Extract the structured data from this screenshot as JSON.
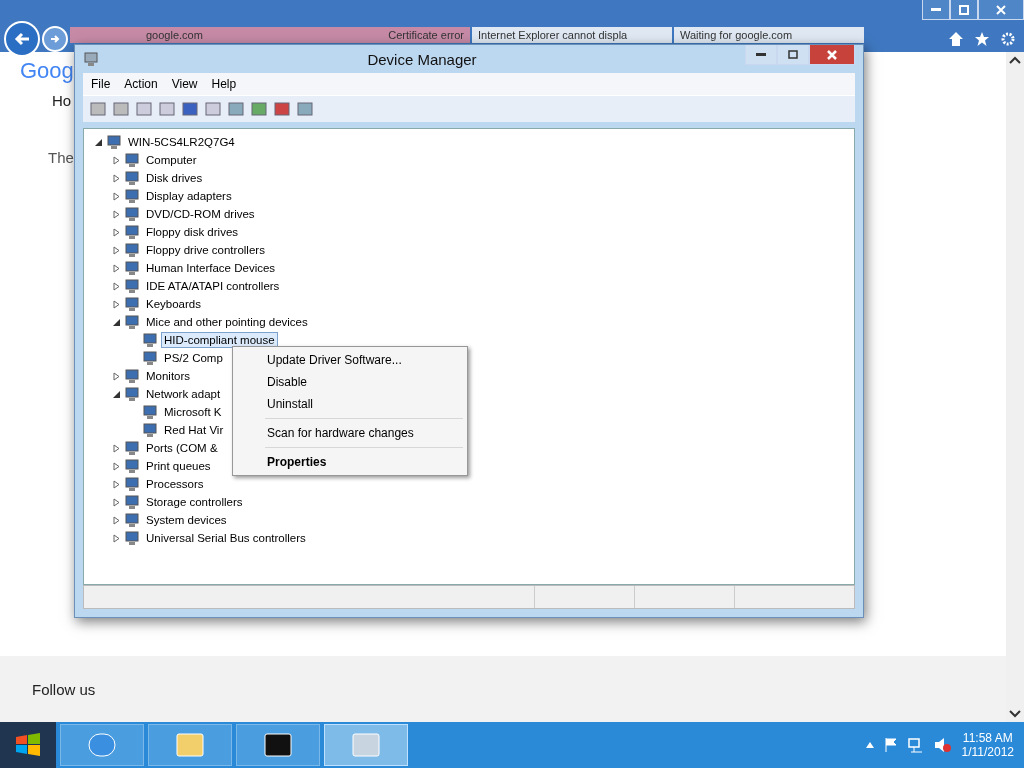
{
  "browser": {
    "tabs": [
      {
        "label": "google.com",
        "selected": true,
        "badge": "Certificate error"
      },
      {
        "label": "Internet Explorer cannot displa",
        "selected": false
      },
      {
        "label": "Waiting for google.com",
        "selected": false
      }
    ],
    "page": {
      "logo": "Goog",
      "nav": "Ho",
      "heading": "The",
      "footer": "Follow us"
    }
  },
  "window": {
    "title": "Device Manager",
    "menu": [
      "File",
      "Action",
      "View",
      "Help"
    ],
    "tree": {
      "label": "WIN-5CS4LR2Q7G4",
      "expanded": true,
      "children": [
        {
          "label": "Computer",
          "expanded": false
        },
        {
          "label": "Disk drives",
          "expanded": false
        },
        {
          "label": "Display adapters",
          "expanded": false
        },
        {
          "label": "DVD/CD-ROM drives",
          "expanded": false
        },
        {
          "label": "Floppy disk drives",
          "expanded": false
        },
        {
          "label": "Floppy drive controllers",
          "expanded": false
        },
        {
          "label": "Human Interface Devices",
          "expanded": false
        },
        {
          "label": "IDE ATA/ATAPI controllers",
          "expanded": false
        },
        {
          "label": "Keyboards",
          "expanded": false
        },
        {
          "label": "Mice and other pointing devices",
          "expanded": true,
          "children": [
            {
              "label": "HID-compliant mouse",
              "selected": true
            },
            {
              "label": "PS/2 Comp",
              "selected": false
            }
          ]
        },
        {
          "label": "Monitors",
          "expanded": false
        },
        {
          "label": "Network adapt",
          "expanded": true,
          "children": [
            {
              "label": "Microsoft K",
              "selected": false
            },
            {
              "label": "Red Hat Vir",
              "selected": false
            }
          ]
        },
        {
          "label": "Ports (COM &",
          "expanded": false
        },
        {
          "label": "Print queues",
          "expanded": false
        },
        {
          "label": "Processors",
          "expanded": false
        },
        {
          "label": "Storage controllers",
          "expanded": false
        },
        {
          "label": "System devices",
          "expanded": false
        },
        {
          "label": "Universal Serial Bus controllers",
          "expanded": false
        }
      ]
    }
  },
  "context_menu": [
    {
      "kind": "item",
      "label": "Update Driver Software...",
      "default": false
    },
    {
      "kind": "item",
      "label": "Disable",
      "default": false
    },
    {
      "kind": "item",
      "label": "Uninstall",
      "default": false
    },
    {
      "kind": "separator"
    },
    {
      "kind": "item",
      "label": "Scan for hardware changes",
      "default": false
    },
    {
      "kind": "separator"
    },
    {
      "kind": "item",
      "label": "Properties",
      "default": true
    }
  ],
  "taskbar": {
    "time": "11:58 AM",
    "date": "1/11/2012"
  }
}
